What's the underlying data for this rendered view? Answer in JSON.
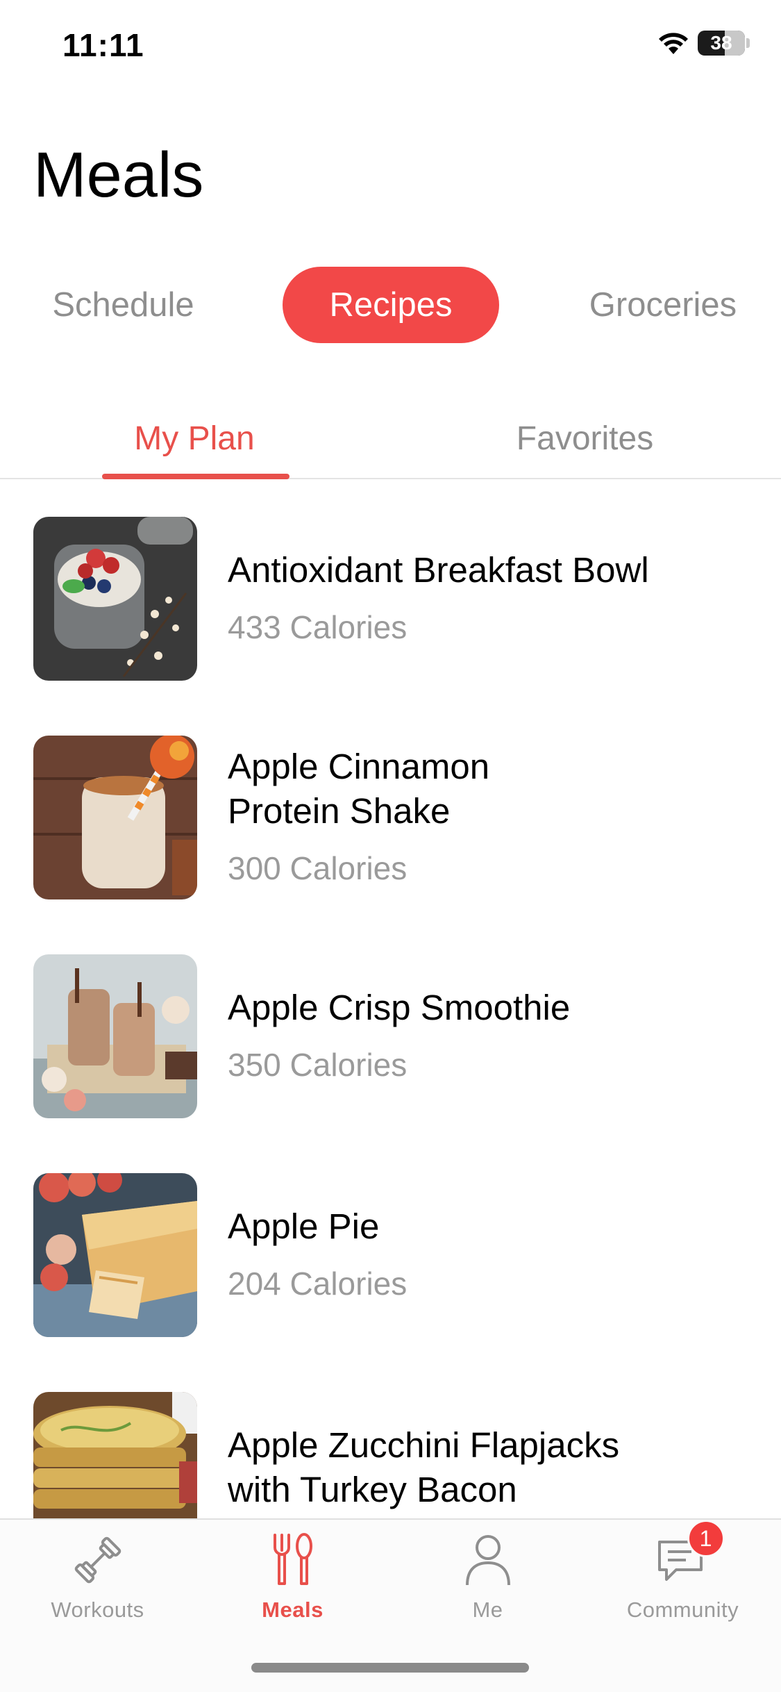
{
  "status": {
    "time": "11:11",
    "battery": "38",
    "battery_level_fraction": 0.38
  },
  "page_title": "Meals",
  "segments": {
    "schedule": "Schedule",
    "recipes": "Recipes",
    "groceries": "Groceries",
    "selected": "Recipes"
  },
  "subtabs": {
    "my_plan": "My Plan",
    "favorites": "Favorites",
    "selected": "My Plan"
  },
  "recipes": [
    {
      "name": "Antioxidant Breakfast Bowl",
      "calories": "433 Calories"
    },
    {
      "name": "Apple Cinnamon\nProtein Shake",
      "calories": "300 Calories"
    },
    {
      "name": "Apple Crisp Smoothie",
      "calories": "350 Calories"
    },
    {
      "name": "Apple Pie",
      "calories": "204 Calories"
    },
    {
      "name": "Apple Zucchini Flapjacks\nwith Turkey Bacon",
      "calories": ""
    }
  ],
  "tab_bar": {
    "workouts": "Workouts",
    "meals": "Meals",
    "me": "Me",
    "community": "Community",
    "community_badge": "1",
    "selected": "Meals"
  },
  "colors": {
    "accent": "#f24848",
    "inactive": "#8e8e8e"
  }
}
